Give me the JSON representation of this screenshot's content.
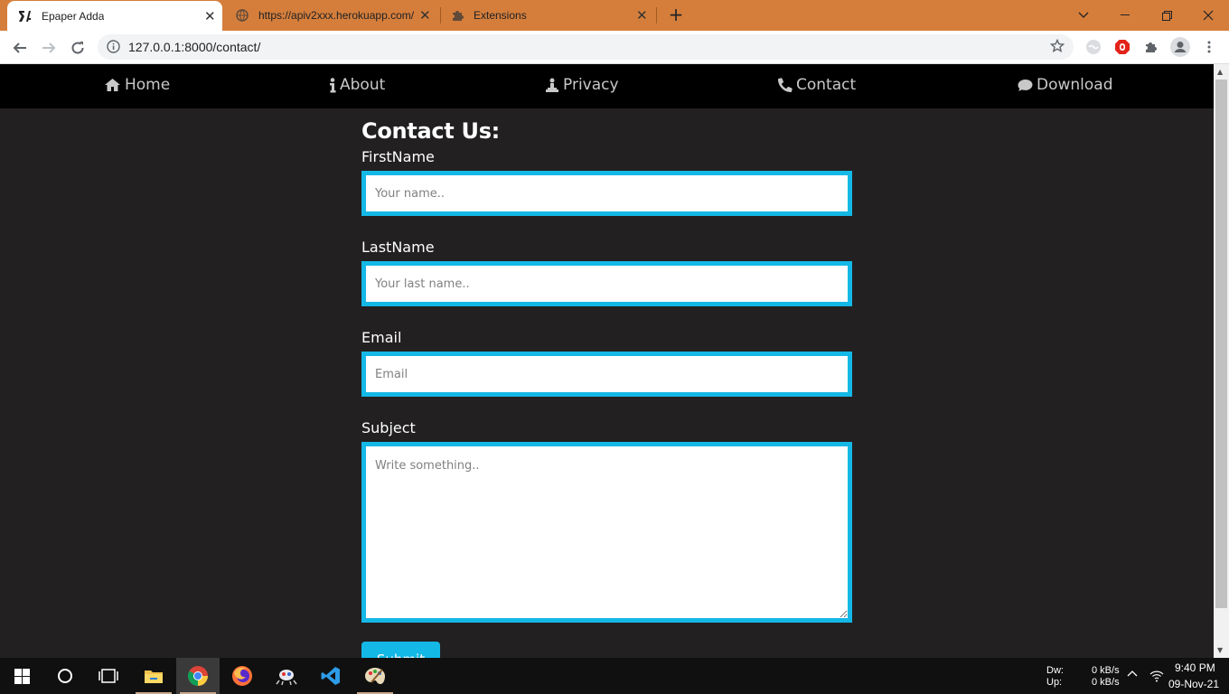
{
  "browser": {
    "tabs": [
      {
        "label": "Epaper Adda",
        "icon": "epaper-adda-favicon",
        "active": true
      },
      {
        "label": "https://apiv2xxx.herokuapp.com/",
        "icon": "globe-icon",
        "active": false
      },
      {
        "label": "Extensions",
        "icon": "puzzle-icon",
        "active": false
      }
    ],
    "url": "127.0.0.1:8000/contact/",
    "tabbar_color": "#d57e3b"
  },
  "site": {
    "nav": [
      {
        "label": "Home",
        "icon": "home-icon"
      },
      {
        "label": "About",
        "icon": "info-icon"
      },
      {
        "label": "Privacy",
        "icon": "privacy-icon"
      },
      {
        "label": "Contact",
        "icon": "phone-icon"
      },
      {
        "label": "Download",
        "icon": "comment-icon"
      }
    ],
    "form": {
      "title": "Contact Us:",
      "first_name_label": "FirstName",
      "first_name_placeholder": "Your name..",
      "last_name_label": "LastName",
      "last_name_placeholder": "Your last name..",
      "email_label": "Email",
      "email_placeholder": "Email",
      "subject_label": "Subject",
      "subject_placeholder": "Write something..",
      "submit_label": "Submit"
    },
    "accent_color": "#14b8e6",
    "background_color": "#222021"
  },
  "taskbar": {
    "net_down_label": "Dw:",
    "net_up_label": "Up:",
    "net_down": "0 kB/s",
    "net_up": "0 kB/s",
    "time": "9:40 PM",
    "date": "09-Nov-21"
  }
}
